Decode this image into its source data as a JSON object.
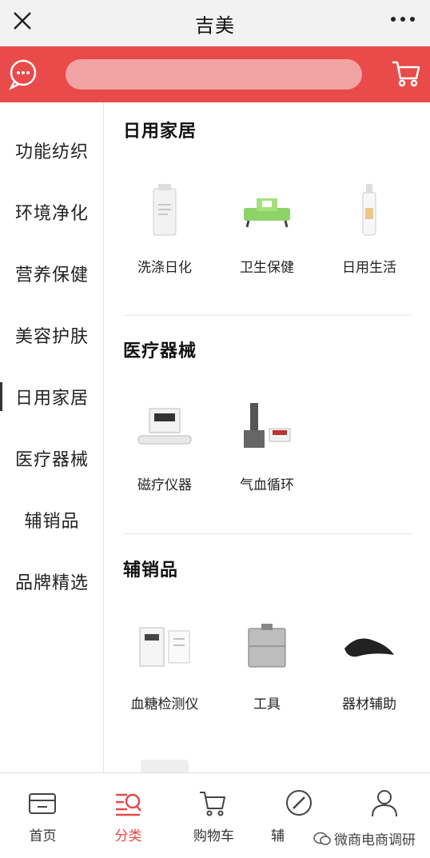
{
  "window": {
    "title": "吉美"
  },
  "search": {
    "text": ""
  },
  "sidebar": {
    "items": [
      {
        "label": "功能纺织"
      },
      {
        "label": "环境净化"
      },
      {
        "label": "营养保健"
      },
      {
        "label": "美容护肤"
      },
      {
        "label": "日用家居"
      },
      {
        "label": "医疗器械"
      },
      {
        "label": "辅销品"
      },
      {
        "label": "品牌精选"
      }
    ],
    "active_index": 4
  },
  "sections": [
    {
      "title": "日用家居",
      "items": [
        {
          "label": "洗涤日化"
        },
        {
          "label": "卫生保健"
        },
        {
          "label": "日用生活"
        }
      ]
    },
    {
      "title": "医疗器械",
      "items": [
        {
          "label": "磁疗仪器"
        },
        {
          "label": "气血循环"
        }
      ]
    },
    {
      "title": "辅销品",
      "items": [
        {
          "label": "血糖检测仪"
        },
        {
          "label": "工具"
        },
        {
          "label": "器材辅助"
        }
      ]
    }
  ],
  "tabbar": {
    "tabs": [
      {
        "label": "首页",
        "icon": "home-icon"
      },
      {
        "label": "分类",
        "icon": "category-icon"
      },
      {
        "label": "购物车",
        "icon": "cart-icon"
      },
      {
        "label": "辅",
        "icon": "compass-icon"
      },
      {
        "label": "",
        "icon": "user-icon"
      }
    ],
    "active_index": 1
  },
  "watermark": {
    "text": "微商电商调研"
  },
  "colors": {
    "brand_red": "#e94a4a",
    "active_tab": "#e34a4a"
  }
}
